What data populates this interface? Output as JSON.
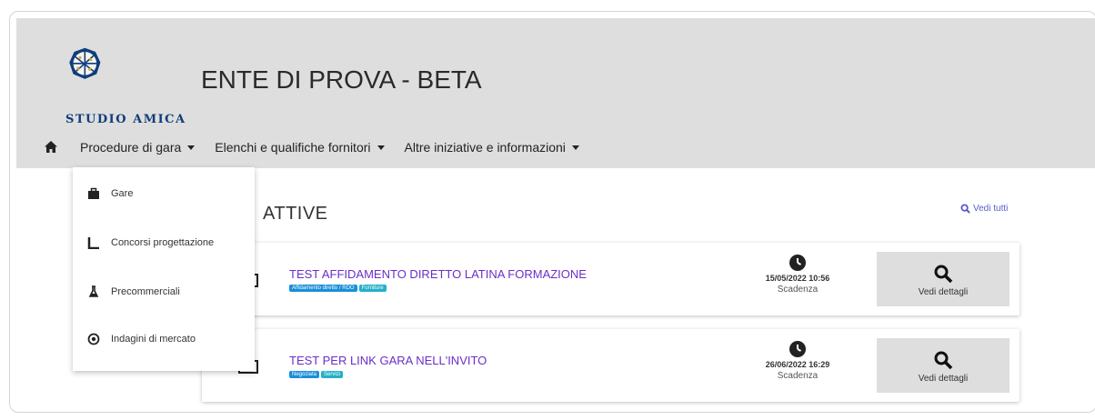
{
  "header": {
    "logo_text": "STUDIO AMICA",
    "site_title": "ENTE DI PROVA - BETA"
  },
  "nav": {
    "home_icon": "home-icon",
    "items": [
      {
        "label": "Procedure di gara"
      },
      {
        "label": "Elenchi e qualifiche fornitori"
      },
      {
        "label": "Altre iniziative e informazioni"
      }
    ]
  },
  "dropdown": {
    "items": [
      {
        "label": "Gare",
        "icon": "briefcase-icon"
      },
      {
        "label": "Concorsi progettazione",
        "icon": "setsquare-icon"
      },
      {
        "label": "Precommerciali",
        "icon": "flask-icon"
      },
      {
        "label": "Indagini di mercato",
        "icon": "target-icon"
      }
    ]
  },
  "section": {
    "title": "ATTIVE",
    "view_all": "Vedi tutti"
  },
  "cards": [
    {
      "title": "TEST AFFIDAMENTO DIRETTO LATINA FORMAZIONE",
      "badges": [
        "Affidamento diretto / RDO",
        "Forniture"
      ],
      "deadline_date": "15/05/2022 10:56",
      "deadline_label": "Scadenza",
      "details_label": "Vedi dettagli"
    },
    {
      "title": "TEST PER LINK GARA NELL'INVITO",
      "badges": [
        "Negoziata",
        "Servizi"
      ],
      "deadline_date": "26/06/2022 16:29",
      "deadline_label": "Scadenza",
      "details_label": "Vedi dettagli"
    }
  ],
  "colors": {
    "header_bg": "#dedede",
    "title_link": "#6a2fc9",
    "badge_primary": "#1a8fd8",
    "badge_secondary": "#25b0c8",
    "logo_blue": "#0f3d7a"
  }
}
